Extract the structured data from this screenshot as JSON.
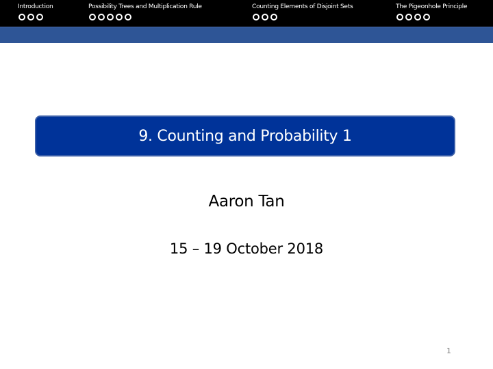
{
  "navigation": {
    "sections": [
      {
        "label": "Introduction",
        "slides": 3
      },
      {
        "label": "Possibility Trees and Multiplication Rule",
        "slides": 5
      },
      {
        "label": "Counting Elements of Disjoint Sets",
        "slides": 3
      },
      {
        "label": "The Pigeonhole Principle",
        "slides": 4
      }
    ]
  },
  "slide": {
    "title": "9. Counting and Probability 1",
    "author": "Aaron Tan",
    "date": "15 – 19 October 2018",
    "page_number": "1"
  },
  "colors": {
    "nav_background": "#000000",
    "accent_bar": "#2e5596",
    "title_box": "#003399",
    "title_box_border": "#3a5ea8",
    "page_number": "#808080"
  }
}
